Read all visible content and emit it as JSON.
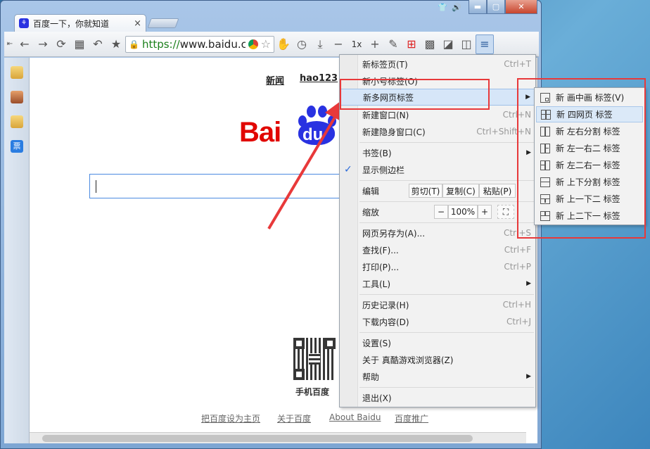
{
  "tab": {
    "title": "百度一下，你就知道",
    "close": "×"
  },
  "address": {
    "scheme": "https://",
    "host": "www.baidu.c"
  },
  "toolbar": {
    "zoom_label": "1x"
  },
  "page": {
    "top_links": [
      "新闻",
      "hao123"
    ],
    "logo_left": "Bai",
    "logo_right": "du",
    "qr_caption": "手机百度",
    "footer_links": [
      "把百度设为主页",
      "关于百度",
      "About Baidu",
      "百度推广"
    ]
  },
  "menu": {
    "items": [
      {
        "label": "新标签页(T)",
        "shortcut": "Ctrl+T"
      },
      {
        "label": "新小号标签(O)",
        "shortcut": ""
      },
      {
        "label": "新多网页标签",
        "shortcut": ""
      },
      {
        "label": "新建窗口(N)",
        "shortcut": "Ctrl+N"
      },
      {
        "label": "新建隐身窗口(C)",
        "shortcut": "Ctrl+Shift+N"
      },
      {
        "label": "书签(B)",
        "shortcut": ""
      },
      {
        "label": "显示侧边栏",
        "shortcut": ""
      },
      {
        "label": "编辑",
        "shortcut": ""
      },
      {
        "label": "缩放",
        "shortcut": ""
      },
      {
        "label": "网页另存为(A)...",
        "shortcut": "Ctrl+S"
      },
      {
        "label": "查找(F)...",
        "shortcut": "Ctrl+F"
      },
      {
        "label": "打印(P)...",
        "shortcut": "Ctrl+P"
      },
      {
        "label": "工具(L)",
        "shortcut": ""
      },
      {
        "label": "历史记录(H)",
        "shortcut": "Ctrl+H"
      },
      {
        "label": "下载内容(D)",
        "shortcut": "Ctrl+J"
      },
      {
        "label": "设置(S)",
        "shortcut": ""
      },
      {
        "label": "关于 真酷游戏浏览器(Z)",
        "shortcut": ""
      },
      {
        "label": "帮助",
        "shortcut": ""
      },
      {
        "label": "退出(X)",
        "shortcut": ""
      }
    ],
    "edit": {
      "cut": "剪切(T)",
      "copy": "复制(C)",
      "paste": "粘贴(P)"
    },
    "zoom": {
      "minus": "−",
      "value": "100%",
      "plus": "+"
    },
    "checkmark": "✓"
  },
  "submenu": {
    "items": [
      "新 画中画 标签(V)",
      "新 四网页 标签",
      "新 左右分割 标签",
      "新 左一右二 标签",
      "新 左二右一 标签",
      "新 上下分割 标签",
      "新 上一下二 标签",
      "新 上二下一 标签"
    ]
  },
  "colors": {
    "accent": "#e8393a",
    "baidu_red": "#e10601",
    "baidu_blue": "#2932e1",
    "link_green": "#1a7f1a"
  }
}
